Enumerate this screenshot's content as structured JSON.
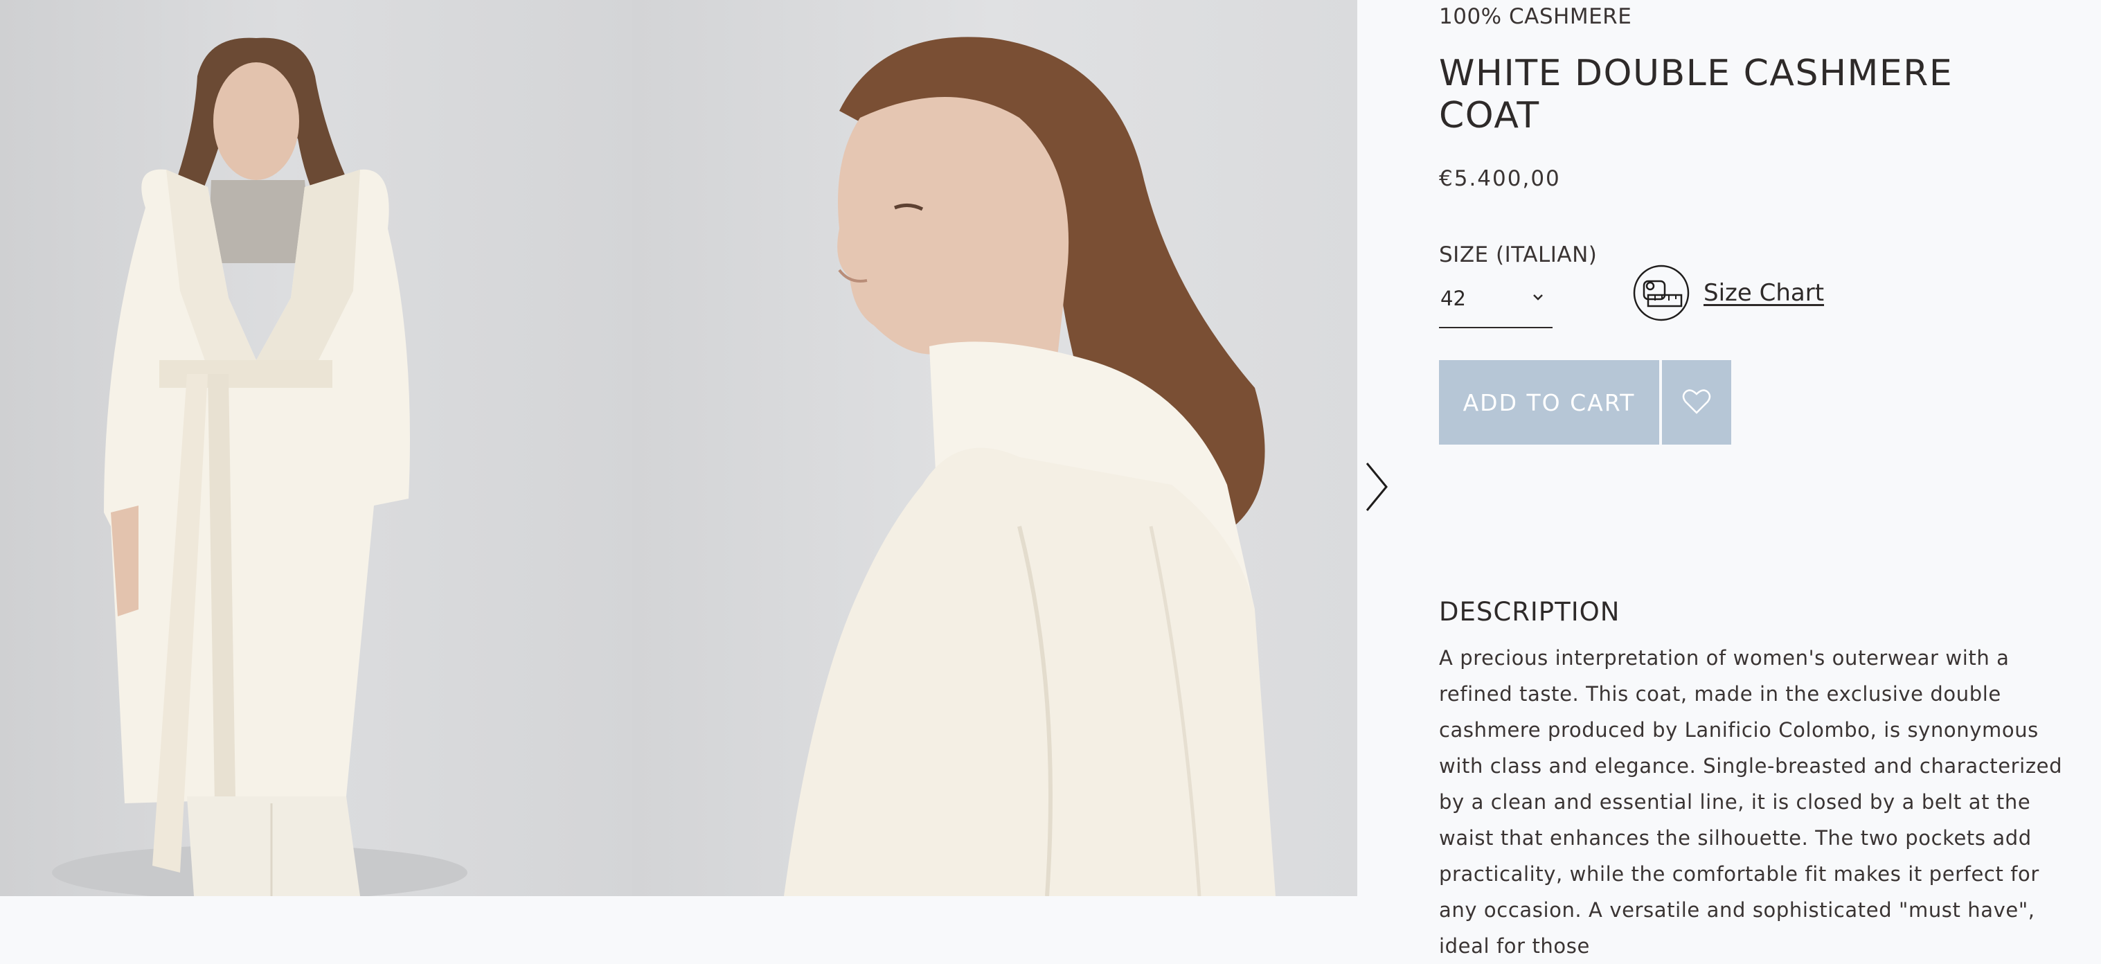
{
  "gallery": {
    "images": [
      {
        "alt": "model-full-length-white-coat"
      },
      {
        "alt": "model-profile-white-coat"
      }
    ],
    "next_icon": "chevron-right-icon"
  },
  "product": {
    "composition": "100% CASHMERE",
    "title": "WHITE DOUBLE CASHMERE COAT",
    "price": "€5.400,00",
    "size_label": "SIZE (ITALIAN)",
    "size_selected": "42",
    "size_chart_icon": "measuring-tape-icon",
    "size_chart_label": "Size Chart",
    "add_to_cart_label": "ADD TO CART",
    "wishlist_icon": "heart-icon",
    "description_heading": "DESCRIPTION",
    "description": "A precious interpretation of women's outerwear with a refined taste. This coat, made in the exclusive double cashmere produced by Lanificio Colombo, is synonymous with class and elegance. Single-breasted and characterized by a clean and essential line, it is closed by a belt at the waist that enhances the silhouette. The two pockets add practicality, while the comfortable fit makes it perfect for any occasion. A versatile and sophisticated \"must have\", ideal for those"
  },
  "colors": {
    "background": "#f8f9fb",
    "button": "#b6c6d6",
    "text": "#2e2a29"
  }
}
